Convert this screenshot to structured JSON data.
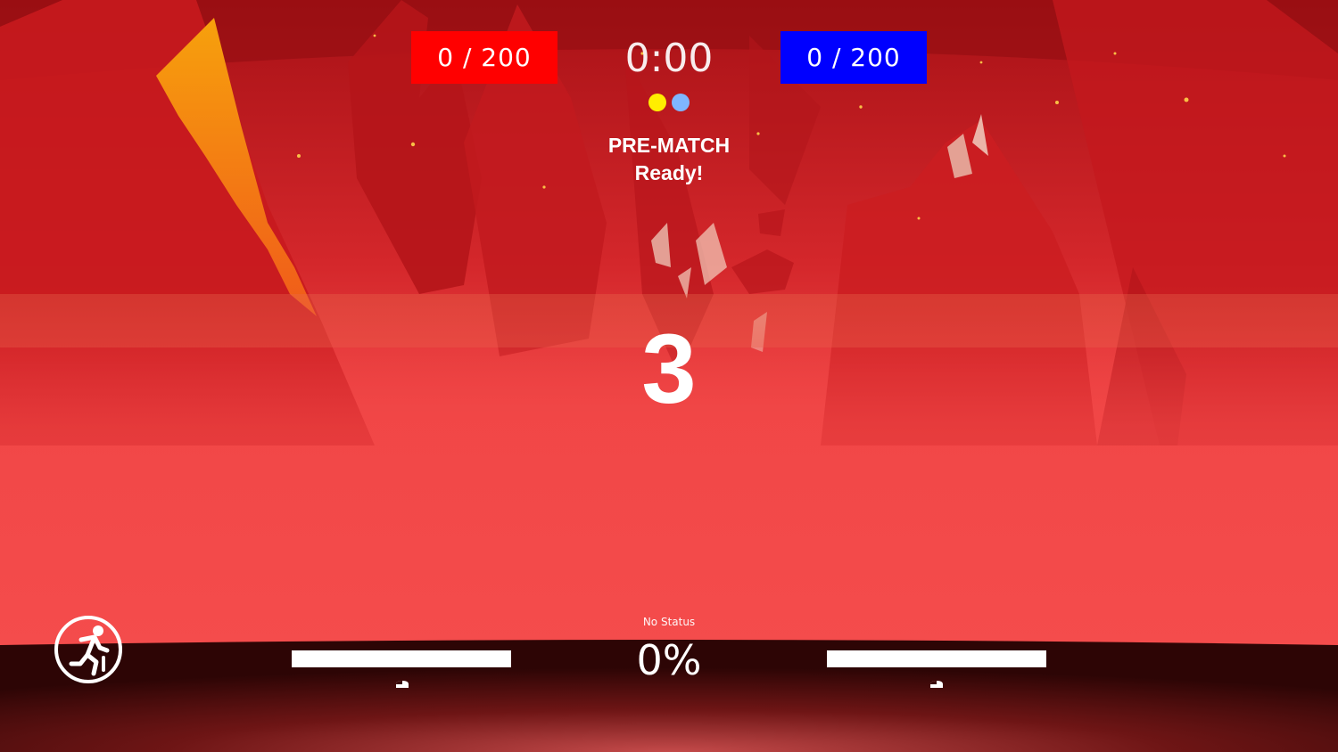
{
  "hud": {
    "red_team_score": "0 / 200",
    "blue_team_score": "0 / 200",
    "timer": "0:00",
    "status_title": "PRE-MATCH",
    "status_subtitle": "Ready!",
    "countdown": "3",
    "player_dots": [
      {
        "name": "player-1",
        "color": "#ffee00"
      },
      {
        "name": "player-2",
        "color": "#7fb6ff"
      }
    ]
  },
  "footer": {
    "status_label": "No Status",
    "capture_percent": "0%",
    "capture_progress": 0,
    "exit_icon": "running-exit-icon"
  },
  "colors": {
    "red_team": "#ff0000",
    "blue_team": "#0000ff",
    "scene_sky": "#c1151b",
    "scene_fog": "#f24a4a",
    "floor": "#3a0707"
  }
}
